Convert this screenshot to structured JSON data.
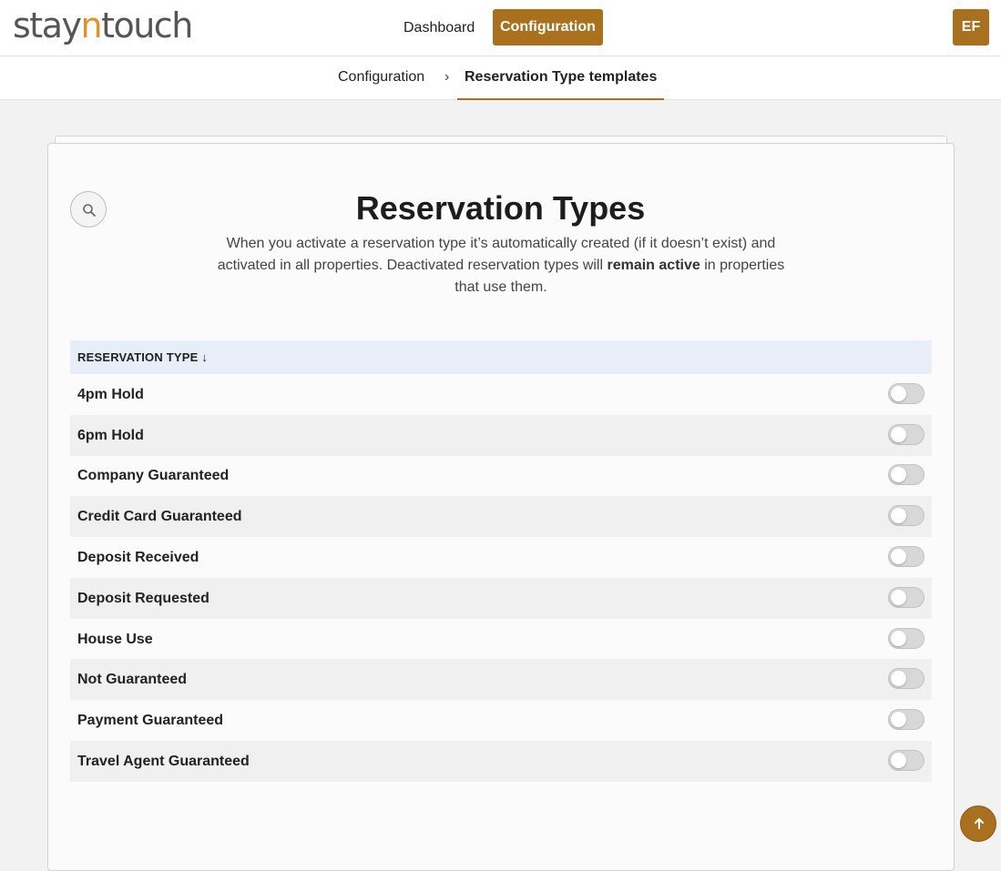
{
  "brand": {
    "logo_part1": "stay",
    "logo_part2": "n",
    "logo_part3": "touch",
    "accent_color": "#e29327",
    "primary_color": "#a9701e"
  },
  "topnav": {
    "dashboard_label": "Dashboard",
    "configuration_label": "Configuration",
    "active": "Configuration",
    "user_initials": "EF"
  },
  "breadcrumb": {
    "root": "Configuration",
    "separator": "›",
    "current": "Reservation Type templates"
  },
  "page": {
    "title": "Reservation Types",
    "description_part1": "When you activate a reservation type it’s automatically created (if it doesn’t exist) and activated in all properties. Deactivated reservation types will ",
    "description_bold": "remain active",
    "description_part2": " in properties that use them.",
    "search_icon": "search-icon"
  },
  "table": {
    "header_label": "RESERVATION TYPE ↓",
    "rows": [
      {
        "label": "4pm Hold",
        "active": false
      },
      {
        "label": "6pm Hold",
        "active": false
      },
      {
        "label": "Company Guaranteed",
        "active": false
      },
      {
        "label": "Credit Card Guaranteed",
        "active": false
      },
      {
        "label": "Deposit Received",
        "active": false
      },
      {
        "label": "Deposit Requested",
        "active": false
      },
      {
        "label": "House Use",
        "active": false
      },
      {
        "label": "Not Guaranteed",
        "active": false
      },
      {
        "label": "Payment Guaranteed",
        "active": false
      },
      {
        "label": "Travel Agent Guaranteed",
        "active": false
      }
    ]
  },
  "scroll_top_icon": "arrow-up-icon"
}
